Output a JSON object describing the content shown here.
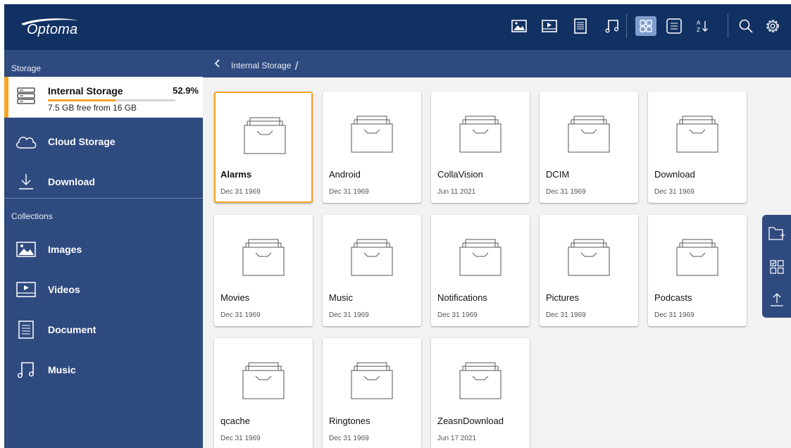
{
  "app": {
    "brand": "Optoma"
  },
  "toolbar": {
    "icons": [
      "images-filter-icon",
      "videos-filter-icon",
      "document-filter-icon",
      "music-filter-icon",
      "grid-view-icon",
      "list-view-icon",
      "sort-az-icon",
      "search-icon",
      "settings-icon"
    ],
    "active_view": "grid"
  },
  "sidebar": {
    "storage_label": "Storage",
    "internal": {
      "name": "Internal Storage",
      "percent": "52.9%",
      "used_fraction": 0.529,
      "free_text": "7.5 GB free from 16 GB"
    },
    "storage_items": [
      {
        "label": "Cloud Storage",
        "icon": "cloud-icon"
      },
      {
        "label": "Download",
        "icon": "download-icon"
      }
    ],
    "collections_label": "Collections",
    "collections": [
      {
        "label": "Images",
        "icon": "images-icon"
      },
      {
        "label": "Videos",
        "icon": "videos-icon"
      },
      {
        "label": "Document",
        "icon": "document-icon"
      },
      {
        "label": "Music",
        "icon": "music-icon"
      }
    ]
  },
  "breadcrumb": {
    "path": "Internal Storage",
    "separator": "/"
  },
  "folders": [
    {
      "name": "Alarms",
      "date": "Dec 31 1969",
      "selected": true
    },
    {
      "name": "Android",
      "date": "Dec 31 1969"
    },
    {
      "name": "CollaVision",
      "date": "Jun 11 2021"
    },
    {
      "name": "DCIM",
      "date": "Dec 31 1969"
    },
    {
      "name": "Download",
      "date": "Dec 31 1969"
    },
    {
      "name": "Movies",
      "date": "Dec 31 1969"
    },
    {
      "name": "Music",
      "date": "Dec 31 1969"
    },
    {
      "name": "Notifications",
      "date": "Dec 31 1969"
    },
    {
      "name": "Pictures",
      "date": "Dec 31 1969"
    },
    {
      "name": "Podcasts",
      "date": "Dec 31 1969"
    },
    {
      "name": "qcache",
      "date": "Dec 31 1969"
    },
    {
      "name": "Ringtones",
      "date": "Dec 31 1969"
    },
    {
      "name": "ZeasnDownload",
      "date": "Jun 17 2021"
    }
  ],
  "float_panel": {
    "icons": [
      "new-folder-icon",
      "multi-select-icon",
      "upload-icon"
    ]
  },
  "colors": {
    "topbar": "#123163",
    "sidebar": "#2f4a7f",
    "accent": "#f5a623",
    "active_view": "#7f9dcf"
  }
}
